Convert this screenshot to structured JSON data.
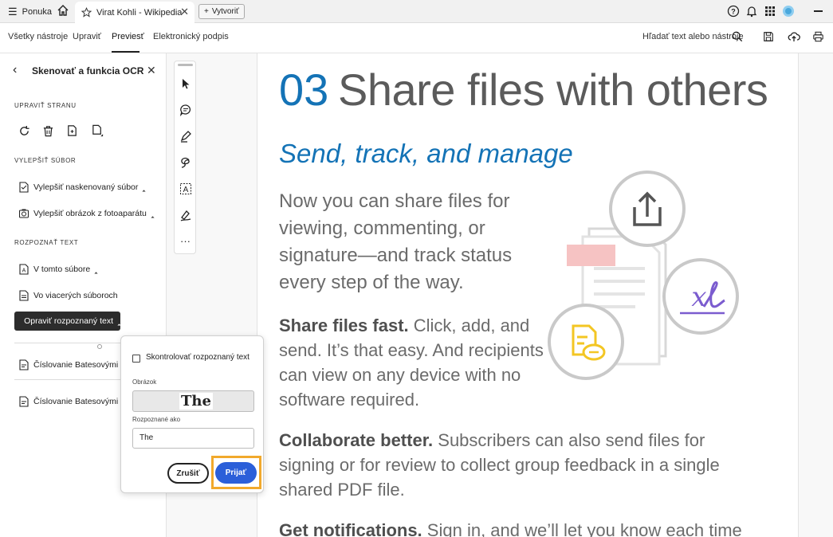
{
  "browser": {
    "menu_label": "Ponuka",
    "tab_title": "Virat Kohli - Wikipedia",
    "new_label": "Vytvoriť"
  },
  "nav": {
    "items": [
      "Všetky nástroje",
      "Upraviť",
      "Previesť",
      "Elektronický podpis"
    ],
    "active": "Previesť",
    "search_label": "Hľadať text alebo nástroje"
  },
  "left_panel": {
    "title": "Skenovať a funkcia OCR",
    "sections": {
      "edit_page": "UPRAVIŤ STRANU",
      "enhance": "VYLEPŠIŤ SÚBOR",
      "recognize": "ROZPOZNAŤ TEXT"
    },
    "enhance_items": [
      "Vylepšiť naskenovaný súbor",
      "Vylepšiť obrázok z fotoaparátu"
    ],
    "recognize_items": [
      "V tomto súbore",
      "Vo viacerých súboroch"
    ],
    "selected_item": "Opraviť rozpoznaný text",
    "bates_items": [
      "Číslovanie Batesovými čísl",
      "Číslovanie Batesovými čísl"
    ]
  },
  "popup": {
    "checkbox_label": "Skontrolovať rozpoznaný text",
    "image_label": "Obrázok",
    "image_text": "The",
    "recognized_label": "Rozpoznané ako",
    "recognized_value": "The",
    "cancel_label": "Zrušiť",
    "accept_label": "Prijať"
  },
  "document": {
    "number": "03",
    "title": "Share files with others",
    "subtitle": "Send, track, and manage",
    "intro_lines": [
      "Now you can share files for",
      "viewing, commenting, or",
      "signature—and track status",
      "every step of the way."
    ],
    "share_bold": "Share files fast.",
    "share_lines": [
      " Click, add, and",
      "send. It’s that easy. And recipients",
      "can view on any device with no",
      "software required."
    ],
    "collab_bold": "Collaborate better.",
    "collab_lines": [
      " Subscribers can also send files for",
      "signing or for review to collect group feedback in a single",
      "shared PDF file."
    ],
    "notify_bold": "Get notifications.",
    "notify_rest": " Sign in, and we’ll let you know each time"
  },
  "colors": {
    "accent_blue": "#1473b6",
    "button_blue": "#2b5fd9",
    "highlight_orange": "#f1a92c",
    "sign_purple": "#7b5ccf",
    "pink_bar": "#f6c3c3",
    "note_yellow": "#f3c623"
  }
}
